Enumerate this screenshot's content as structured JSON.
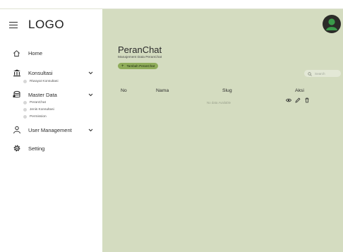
{
  "sidebar": {
    "logo": "LOGO",
    "menu": [
      {
        "label": "Home",
        "icon": "home-icon"
      },
      {
        "label": "Konsultasi",
        "icon": "bank-icon",
        "submenu": [
          "Riwayat Konsultasi"
        ]
      },
      {
        "label": "Master Data",
        "icon": "database-icon",
        "submenu": [
          "PeranChat",
          "Jenis Konsultasi",
          "Permission"
        ]
      },
      {
        "label": "User Management",
        "icon": "user-icon"
      },
      {
        "label": "Setting",
        "icon": "gear-icon"
      }
    ]
  },
  "header": {
    "avatar_icon": "user-avatar-icon"
  },
  "page": {
    "title": "PeranChat",
    "subtitle": "Manajement Data PeranChat",
    "add_button": "Tambah PeranChat",
    "search_placeholder": "Search"
  },
  "table": {
    "columns": [
      "No",
      "Nama",
      "Slug",
      "Aksi"
    ],
    "empty_text": "No data Available",
    "action_icons": [
      "eye-icon",
      "pencil-icon",
      "trash-icon"
    ]
  },
  "colors": {
    "main_bg": "#d4dcc0",
    "accent": "#8fac5a"
  }
}
